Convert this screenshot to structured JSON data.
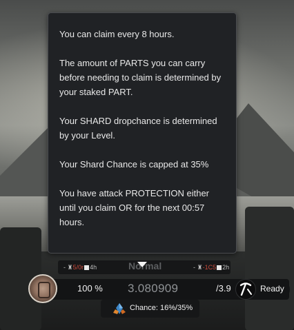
{
  "tooltip": {
    "lines": [
      "You can claim every 8 hours.",
      "The amount of PARTS you can carry before needing to claim is determined by your staked PART.",
      "Your SHARD dropchance is determined by your Level.",
      "Your Shard Chance is capped at 35%",
      "You have attack PROTECTION either until you claim OR for the next 00:57 hours."
    ]
  },
  "strip": {
    "left_prefix": "-",
    "left_red": "5/0r",
    "left_suffix": "4h",
    "mode_label": "Normal",
    "right_prefix": "-",
    "right_red": "-1C5",
    "right_suffix": "2h"
  },
  "claim_bar": {
    "avatar_icon": "cog-emblem-icon",
    "progress_percent": "100 %",
    "amount": "3.080909",
    "capacity": "/3.9",
    "claim_icon": "pickaxe-icon",
    "ready_label": "Ready"
  },
  "chance": {
    "icon": "shard-crystal-icon",
    "label": "Chance: 16%/35%"
  },
  "colors": {
    "tooltip_bg": "#202225",
    "bar_bg": "#131415",
    "danger": "#c94a3c"
  }
}
